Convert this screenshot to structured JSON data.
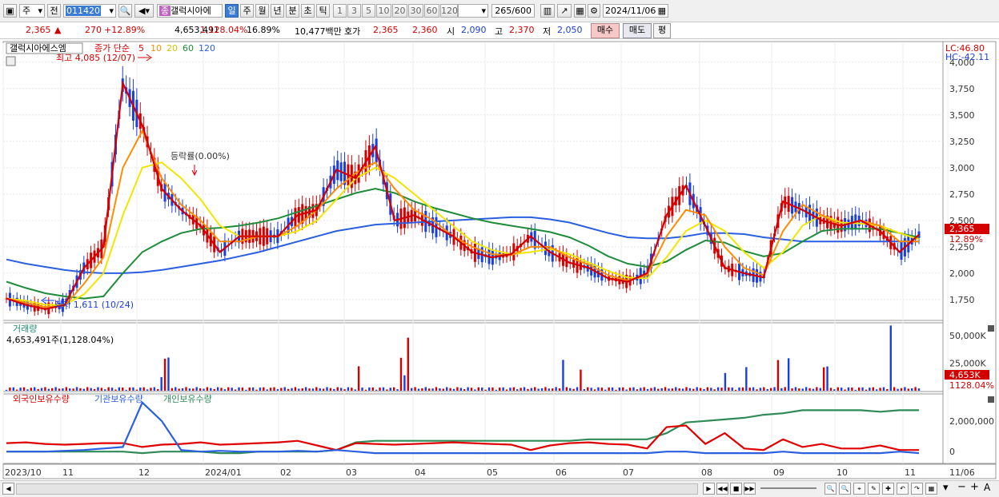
{
  "toolbar": {
    "market_select": "주",
    "prev_label": "전",
    "code_value": "011420",
    "stock_name": "갤럭시아에",
    "stock_badge": "종",
    "periods": [
      "일",
      "주",
      "월",
      "년",
      "분",
      "초",
      "틱"
    ],
    "active_period": "일",
    "intervals": [
      "1",
      "3",
      "5",
      "10",
      "20",
      "30",
      "60",
      "120"
    ],
    "count_value": "265",
    "count_total": "600",
    "date_value": "2024/11/06"
  },
  "quote": {
    "price": "2,365",
    "change": "270",
    "change_pct": "+12.89%",
    "volume": "4,653,491",
    "volume_pct": "1,128.04%",
    "turnover": "16.89%",
    "amount": "10,477백만",
    "ask_label": "호가",
    "ask": "2,365",
    "bid": "2,360",
    "open_label": "시",
    "open": "2,090",
    "high_label": "고",
    "high": "2,370",
    "low_label": "저",
    "low": "2,050",
    "buy_label": "매수",
    "sell_label": "매도",
    "avg_label": "평"
  },
  "colors": {
    "up": "#d40000",
    "down": "#1a3ee0",
    "ma5": "#d40000",
    "ma10": "#ff8c00",
    "ma20": "#f2e600",
    "ma60": "#1e8c3a",
    "ma120": "#2a5fe0",
    "foreign": "#e00000",
    "institution": "#2a5fe0",
    "individual": "#2e8b57"
  },
  "legend": {
    "stock_tab": "갤럭시아에스엠",
    "ma_label": "종가 단순",
    "ma_periods": [
      "5",
      "10",
      "20",
      "60",
      "120"
    ],
    "lc": "LC:46.80",
    "hc": "HC:-42.11"
  },
  "annotations": {
    "high": "최고 4,085 (12/07)",
    "low": "최저 1,611 (10/24)",
    "rate": "등락률(0.00%)"
  },
  "volume_panel": {
    "title": "거래량",
    "value": "4,653,491주(1,128.04%)",
    "cur_label": "4,653K",
    "cur_pct": "1128.04%"
  },
  "holdings_panel": {
    "series": [
      "외국인보유수량",
      "기관보유수량",
      "개인보유수량"
    ]
  },
  "price_labels": {
    "cur_price": "2,365",
    "cur_pct": "12.89%"
  },
  "chart_data": [
    {
      "type": "candlestick",
      "title": "",
      "x_labels": [
        "2023/10",
        "11",
        "12",
        "2024/01",
        "02",
        "03",
        "04",
        "05",
        "06",
        "07",
        "08",
        "09",
        "10",
        "11",
        "11/06"
      ],
      "y_ticks": [
        1750,
        2000,
        2250,
        2500,
        2750,
        3000,
        3250,
        3500,
        3750,
        4000
      ],
      "ylim": [
        1560,
        4180
      ],
      "series": [
        {
          "name": "5",
          "values": [
            1760,
            1700,
            1660,
            1700,
            2050,
            2250,
            3800,
            3400,
            2800,
            2600,
            2450,
            2200,
            2350,
            2350,
            2350,
            2550,
            2600,
            2980,
            2900,
            3200,
            2500,
            2550,
            2450,
            2350,
            2200,
            2150,
            2180,
            2350,
            2200,
            2100,
            2050,
            1950,
            1920,
            2000,
            2550,
            2830,
            2450,
            2050,
            2000,
            1960,
            2680,
            2600,
            2500,
            2450,
            2500,
            2400,
            2200,
            2365
          ]
        },
        {
          "name": "10",
          "values": [
            1760,
            1720,
            1680,
            1690,
            1900,
            2150,
            3000,
            3350,
            2900,
            2650,
            2500,
            2300,
            2300,
            2350,
            2350,
            2450,
            2600,
            2800,
            2950,
            3050,
            2800,
            2600,
            2500,
            2350,
            2250,
            2180,
            2170,
            2250,
            2250,
            2150,
            2080,
            1980,
            1930,
            1980,
            2350,
            2600,
            2550,
            2250,
            2050,
            1980,
            2400,
            2650,
            2550,
            2450,
            2500,
            2450,
            2300,
            2300
          ]
        },
        {
          "name": "20",
          "values": [
            1760,
            1740,
            1700,
            1700,
            1800,
            2000,
            2550,
            3000,
            3050,
            2900,
            2700,
            2450,
            2350,
            2350,
            2350,
            2400,
            2500,
            2700,
            2900,
            3000,
            2900,
            2750,
            2600,
            2450,
            2300,
            2220,
            2180,
            2200,
            2230,
            2180,
            2100,
            2020,
            1960,
            1950,
            2150,
            2400,
            2500,
            2400,
            2200,
            2050,
            2200,
            2450,
            2550,
            2480,
            2470,
            2450,
            2380,
            2320
          ]
        },
        {
          "name": "60",
          "values": [
            1920,
            1860,
            1810,
            1780,
            1760,
            1780,
            2000,
            2200,
            2300,
            2380,
            2420,
            2430,
            2450,
            2480,
            2520,
            2580,
            2640,
            2700,
            2760,
            2800,
            2760,
            2680,
            2620,
            2570,
            2520,
            2480,
            2450,
            2420,
            2390,
            2340,
            2260,
            2160,
            2090,
            2060,
            2110,
            2220,
            2310,
            2290,
            2210,
            2160,
            2190,
            2300,
            2400,
            2420,
            2420,
            2420,
            2380,
            2340
          ]
        },
        {
          "name": "120",
          "values": [
            2130,
            2090,
            2060,
            2030,
            2010,
            2000,
            2000,
            2010,
            2030,
            2060,
            2090,
            2120,
            2160,
            2200,
            2250,
            2300,
            2350,
            2400,
            2430,
            2460,
            2470,
            2480,
            2490,
            2500,
            2510,
            2520,
            2530,
            2530,
            2510,
            2480,
            2430,
            2380,
            2340,
            2330,
            2330,
            2350,
            2380,
            2380,
            2370,
            2340,
            2320,
            2300,
            2300,
            2300,
            2300,
            2300,
            2300,
            2300
          ]
        }
      ]
    },
    {
      "type": "bar",
      "title": "거래량",
      "y_ticks": [
        "25,000K",
        "50,000K"
      ],
      "ylim": [
        0,
        60000
      ]
    },
    {
      "type": "line",
      "title": "",
      "y_ticks": [
        "0",
        "2,000,000"
      ],
      "series": [
        {
          "name": "외국인보유수량",
          "values": [
            0.55,
            0.6,
            0.5,
            0.45,
            0.5,
            0.55,
            0.55,
            0.3,
            0.45,
            0.5,
            0.6,
            0.45,
            0.5,
            0.55,
            0.6,
            0.7,
            0.4,
            0.1,
            0.55,
            0.5,
            0.45,
            0.5,
            0.55,
            0.6,
            0.55,
            0.5,
            0.45,
            0.1,
            0.4,
            0.55,
            0.6,
            0.5,
            0.45,
            0.2,
            1.6,
            1.7,
            0.5,
            1.2,
            0.2,
            0.1,
            0.8,
            0.3,
            0.5,
            0.2,
            0.2,
            0.4,
            0.1,
            0.1
          ]
        },
        {
          "name": "기관보유수량",
          "values": [
            0.0,
            0.0,
            0.0,
            0.05,
            0.1,
            0.2,
            0.3,
            3.2,
            2.0,
            0.1,
            0.0,
            0.05,
            0.0,
            0.0,
            0.0,
            0.05,
            0.0,
            0.1,
            0.0,
            -0.1,
            -0.1,
            -0.1,
            -0.1,
            -0.1,
            -0.1,
            -0.1,
            -0.1,
            -0.1,
            -0.1,
            -0.1,
            -0.1,
            -0.1,
            -0.1,
            -0.1,
            0.0,
            0.0,
            -0.1,
            -0.1,
            -0.1,
            -0.1,
            0.0,
            -0.1,
            -0.1,
            -0.1,
            -0.1,
            -0.1,
            0.0,
            -0.1
          ]
        },
        {
          "name": "개인보유수량",
          "values": [
            0.0,
            0.0,
            0.0,
            0.0,
            0.0,
            0.0,
            0.0,
            -0.1,
            0.0,
            0.0,
            0.0,
            -0.1,
            -0.1,
            0.0,
            0.0,
            0.0,
            0.0,
            0.1,
            0.6,
            0.7,
            0.7,
            0.7,
            0.7,
            0.7,
            0.7,
            0.7,
            0.7,
            0.7,
            0.7,
            0.7,
            0.8,
            0.8,
            0.8,
            0.8,
            1.2,
            1.9,
            2.0,
            2.1,
            2.2,
            2.4,
            2.5,
            2.7,
            2.7,
            2.7,
            2.7,
            2.6,
            2.7,
            2.7
          ]
        }
      ]
    }
  ]
}
